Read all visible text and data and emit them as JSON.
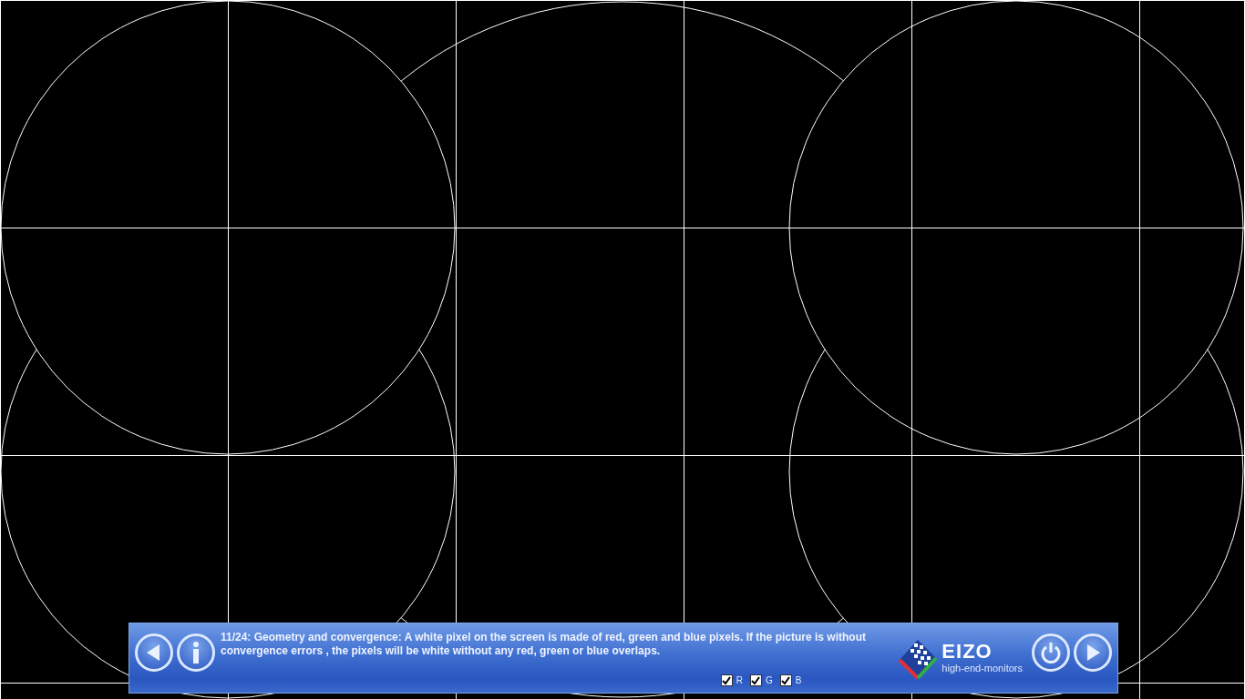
{
  "description": "11/24: Geometry and convergence: A white pixel on the screen is made of red, green and blue pixels. If the picture is without convergence errors , the pixels will be white without any red, green or blue overlaps.",
  "channels": [
    {
      "label": "R",
      "checked": true
    },
    {
      "label": "G",
      "checked": true
    },
    {
      "label": "B",
      "checked": true
    }
  ],
  "logo": {
    "name": "EIZO",
    "tagline": "high-end-monitors"
  }
}
